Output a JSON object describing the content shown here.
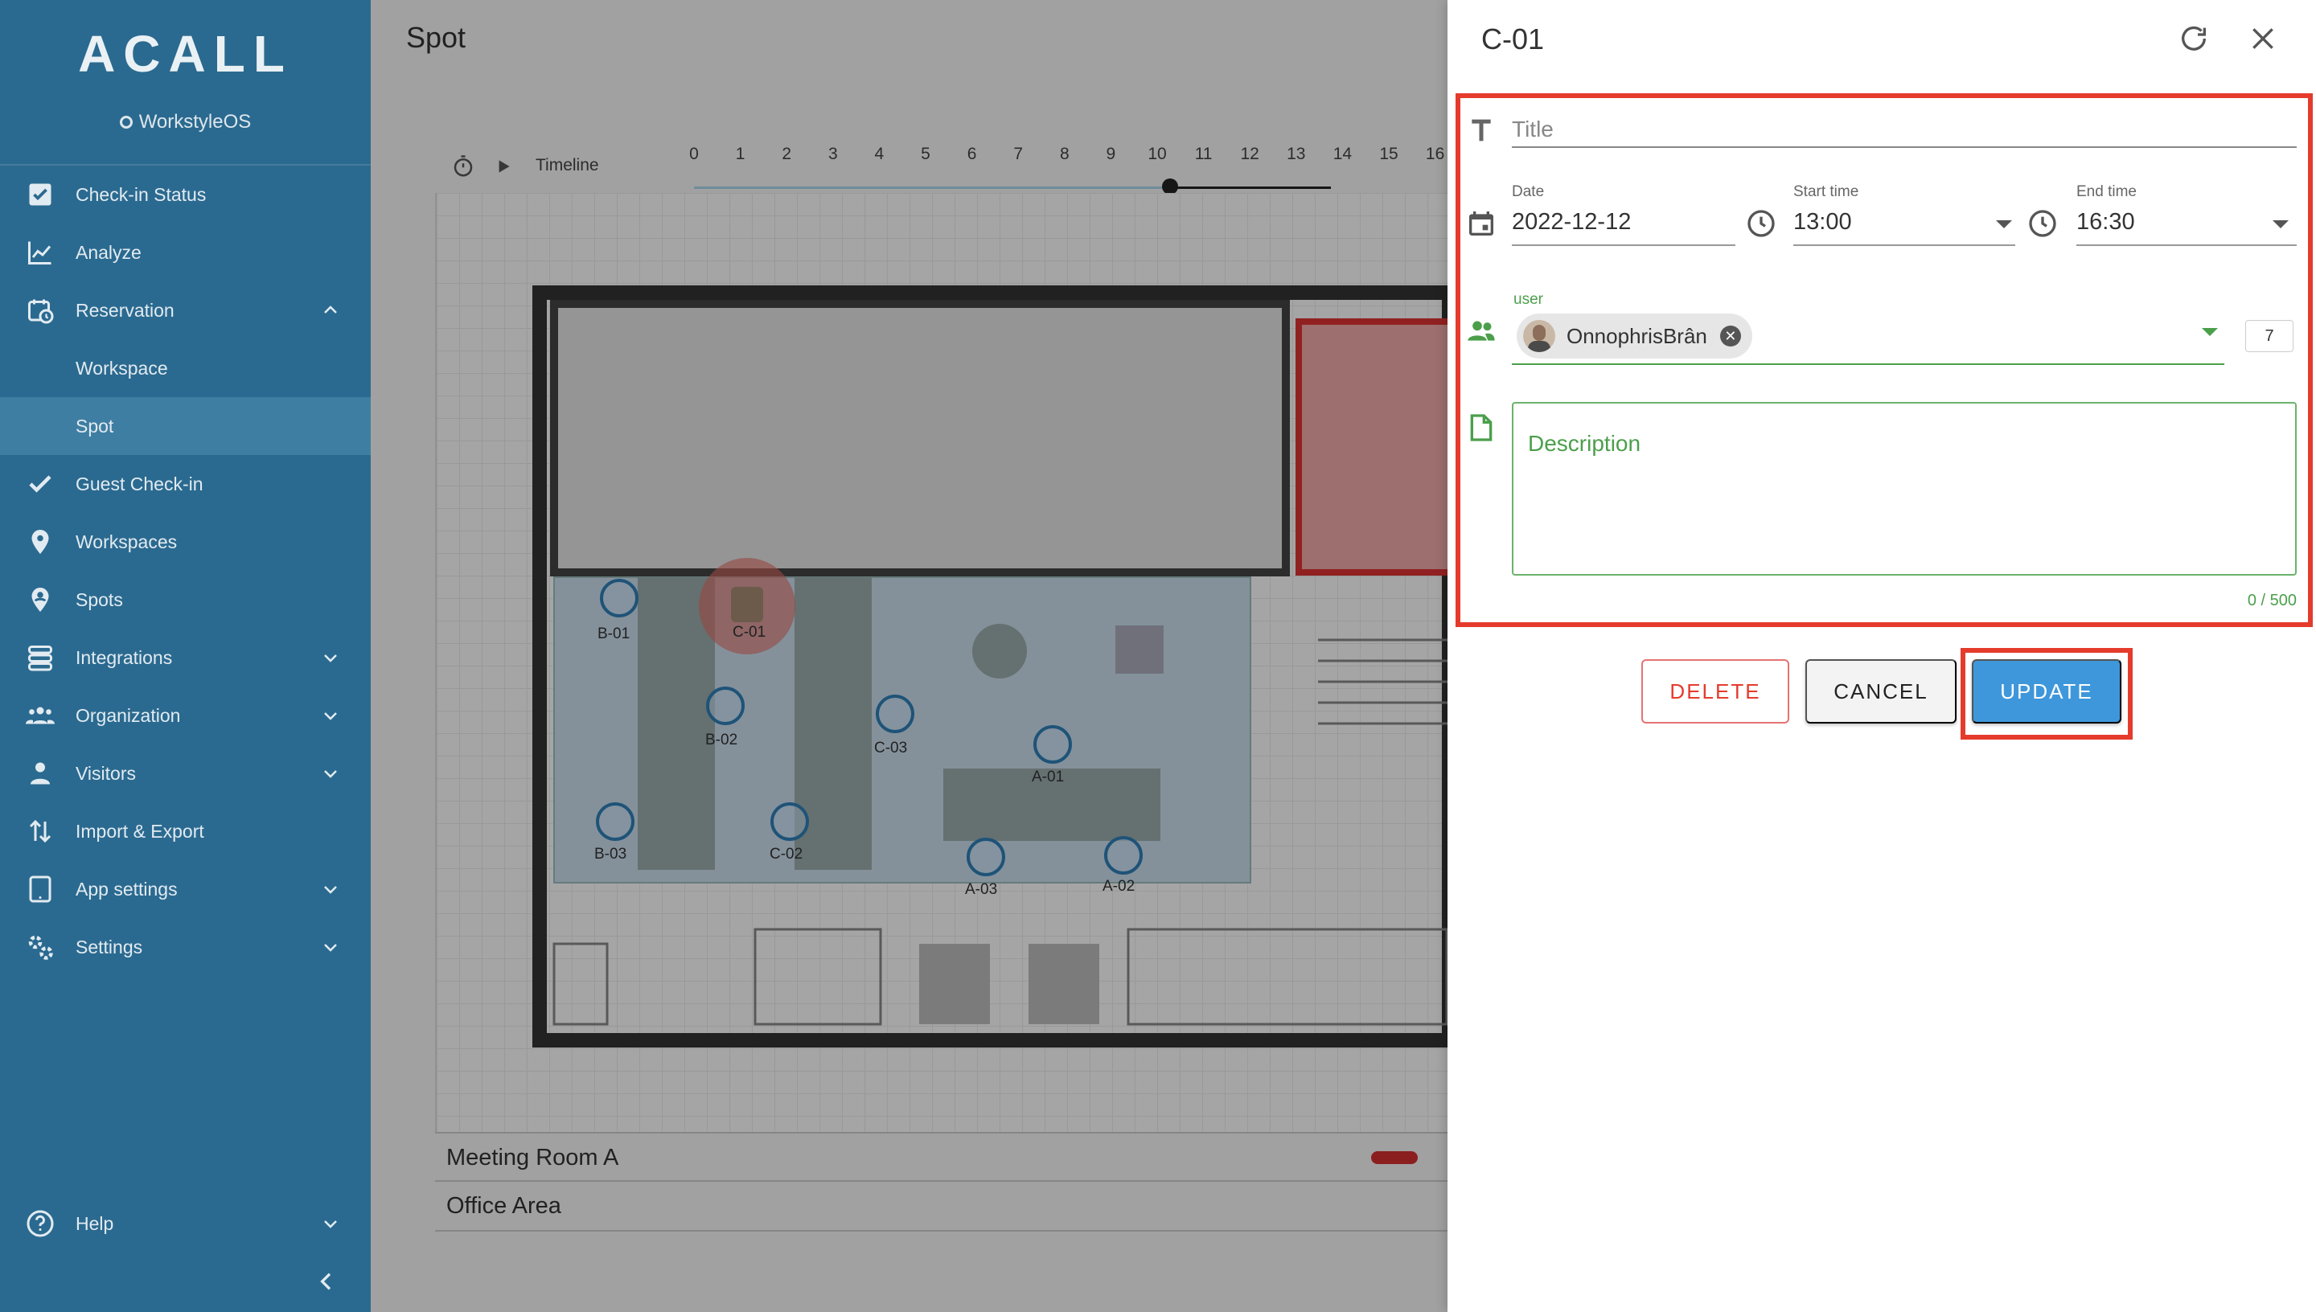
{
  "app": {
    "logo": "ACALL",
    "subbrand": "WorkstyleOS"
  },
  "sidebar": {
    "items": [
      {
        "label": "Check-in Status"
      },
      {
        "label": "Analyze"
      },
      {
        "label": "Reservation"
      },
      {
        "label": "Workspace"
      },
      {
        "label": "Spot"
      },
      {
        "label": "Guest Check-in"
      },
      {
        "label": "Workspaces"
      },
      {
        "label": "Spots"
      },
      {
        "label": "Integrations"
      },
      {
        "label": "Organization"
      },
      {
        "label": "Visitors"
      },
      {
        "label": "Import & Export"
      },
      {
        "label": "App settings"
      },
      {
        "label": "Settings"
      },
      {
        "label": "Help"
      }
    ]
  },
  "main": {
    "page_title": "Spot",
    "timeline_label": "Timeline",
    "hours": [
      "0",
      "1",
      "2",
      "3",
      "4",
      "5",
      "6",
      "7",
      "8",
      "9",
      "10",
      "11",
      "12",
      "13",
      "14",
      "15",
      "16"
    ],
    "spots": [
      "B-01",
      "C-01",
      "B-02",
      "C-03",
      "A-01",
      "B-03",
      "C-02",
      "A-03",
      "A-02"
    ],
    "rooms": [
      "Meeting Room A",
      "Office Area"
    ]
  },
  "drawer": {
    "title": "C-01",
    "title_placeholder": "Title",
    "date_label": "Date",
    "date_value": "2022-12-12",
    "start_label": "Start time",
    "start_value": "13:00",
    "end_label": "End time",
    "end_value": "16:30",
    "user_label": "user",
    "user_chip": "OnnophrisBrân",
    "user_count": "7",
    "description_placeholder": "Description",
    "description_counter": "0 / 500",
    "delete_label": "DELETE",
    "cancel_label": "CANCEL",
    "update_label": "UPDATE"
  },
  "colors": {
    "sidebar_bg": "#2b6a90",
    "sidebar_active": "#3f7ea3",
    "accent_blue": "#3f97db",
    "danger_red": "#e53b2c",
    "success_green": "#4b9f4b"
  }
}
